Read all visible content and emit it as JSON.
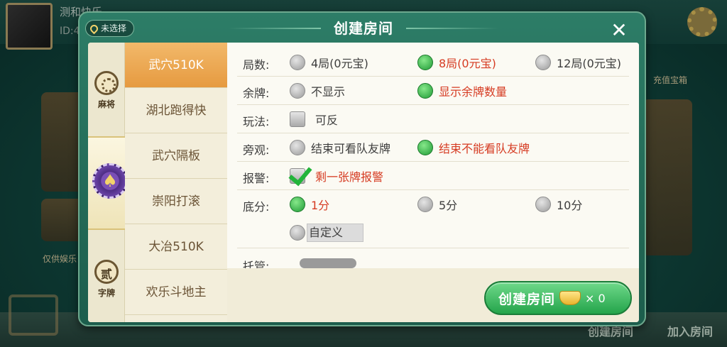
{
  "lobby": {
    "player_name": "测和快乐",
    "player_id": "ID:4",
    "bottom_create": "创建房间",
    "bottom_join": "加入房间",
    "side_text": "仅供娱乐",
    "top_right_label": "充值宝箱"
  },
  "dialog": {
    "title": "创建房间",
    "close_label": "✕",
    "location_label": "未选择"
  },
  "categories": [
    {
      "label": "麻将",
      "icon": "mahjong-icon"
    },
    {
      "label": "",
      "icon": "spade-chip-icon"
    },
    {
      "label": "字牌",
      "icon": "zipai-icon"
    }
  ],
  "games": [
    "武穴510K",
    "湖北跑得快",
    "武穴隔板",
    "崇阳打滚",
    "大冶510K",
    "欢乐斗地主"
  ],
  "active_game": "武穴510K",
  "options": {
    "rounds": {
      "label": "局数:",
      "choices": [
        "4局(0元宝)",
        "8局(0元宝)",
        "12局(0元宝)"
      ],
      "selected": "8局(0元宝)"
    },
    "remaining": {
      "label": "余牌:",
      "choices": [
        "不显示",
        "显示余牌数量"
      ],
      "selected": "显示余牌数量"
    },
    "play": {
      "label": "玩法:",
      "checkbox": "可反",
      "checked": false
    },
    "spectate": {
      "label": "旁观:",
      "choices": [
        "结束可看队友牌",
        "结束不能看队友牌"
      ],
      "selected": "结束不能看队友牌"
    },
    "alarm": {
      "label": "报警:",
      "checkbox": "剩一张牌报警",
      "checked": true
    },
    "base_score": {
      "label": "底分:",
      "choices": [
        "1分",
        "5分",
        "10分"
      ],
      "selected": "1分",
      "custom": "自定义"
    },
    "hosting": {
      "label": "托管:"
    }
  },
  "footer": {
    "create_label": "创建房间",
    "cost": "× 0"
  },
  "colors": {
    "accent_green": "#24a44b",
    "selected_text": "#d63b22",
    "active_tab": "#e69a40"
  }
}
